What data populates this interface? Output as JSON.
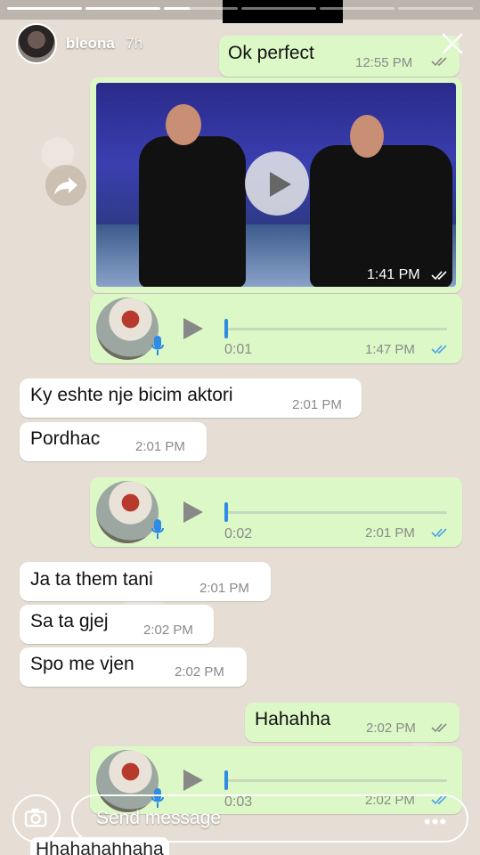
{
  "story": {
    "username": "bleona",
    "time_ago": "7h",
    "progress_bars": [
      1,
      1,
      0.35,
      0,
      0,
      0
    ]
  },
  "messages": {
    "m1": {
      "text": "Ok perfect",
      "time": "12:55 PM"
    },
    "video": {
      "time": "1:41 PM"
    },
    "voice1": {
      "duration": "0:01",
      "time": "1:47 PM",
      "progress": 0.01
    },
    "m2": {
      "text": "Ky eshte nje bicim aktori",
      "time": "2:01 PM"
    },
    "m3": {
      "text": "Pordhac",
      "time": "2:01 PM"
    },
    "voice2": {
      "duration": "0:02",
      "time": "2:01 PM",
      "progress": 0.01
    },
    "m4": {
      "text": "Ja ta them tani",
      "time": "2:01 PM"
    },
    "m5": {
      "text": "Sa ta gjej",
      "time": "2:02 PM"
    },
    "m6": {
      "text": "Spo me vjen",
      "time": "2:02 PM"
    },
    "m7": {
      "text": "Hahahha",
      "time": "2:02 PM"
    },
    "voice3": {
      "duration": "0:03",
      "time": "2:02 PM",
      "progress": 0.01
    },
    "m8": {
      "text": "Hhahahahhaha"
    }
  },
  "composer": {
    "placeholder": "Send message",
    "more": "•••"
  },
  "colors": {
    "outgoing_bubble": "#dcf8c6",
    "incoming_bubble": "#ffffff",
    "read_ticks": "#4fa3e8",
    "wallpaper": "#e6ded4"
  }
}
